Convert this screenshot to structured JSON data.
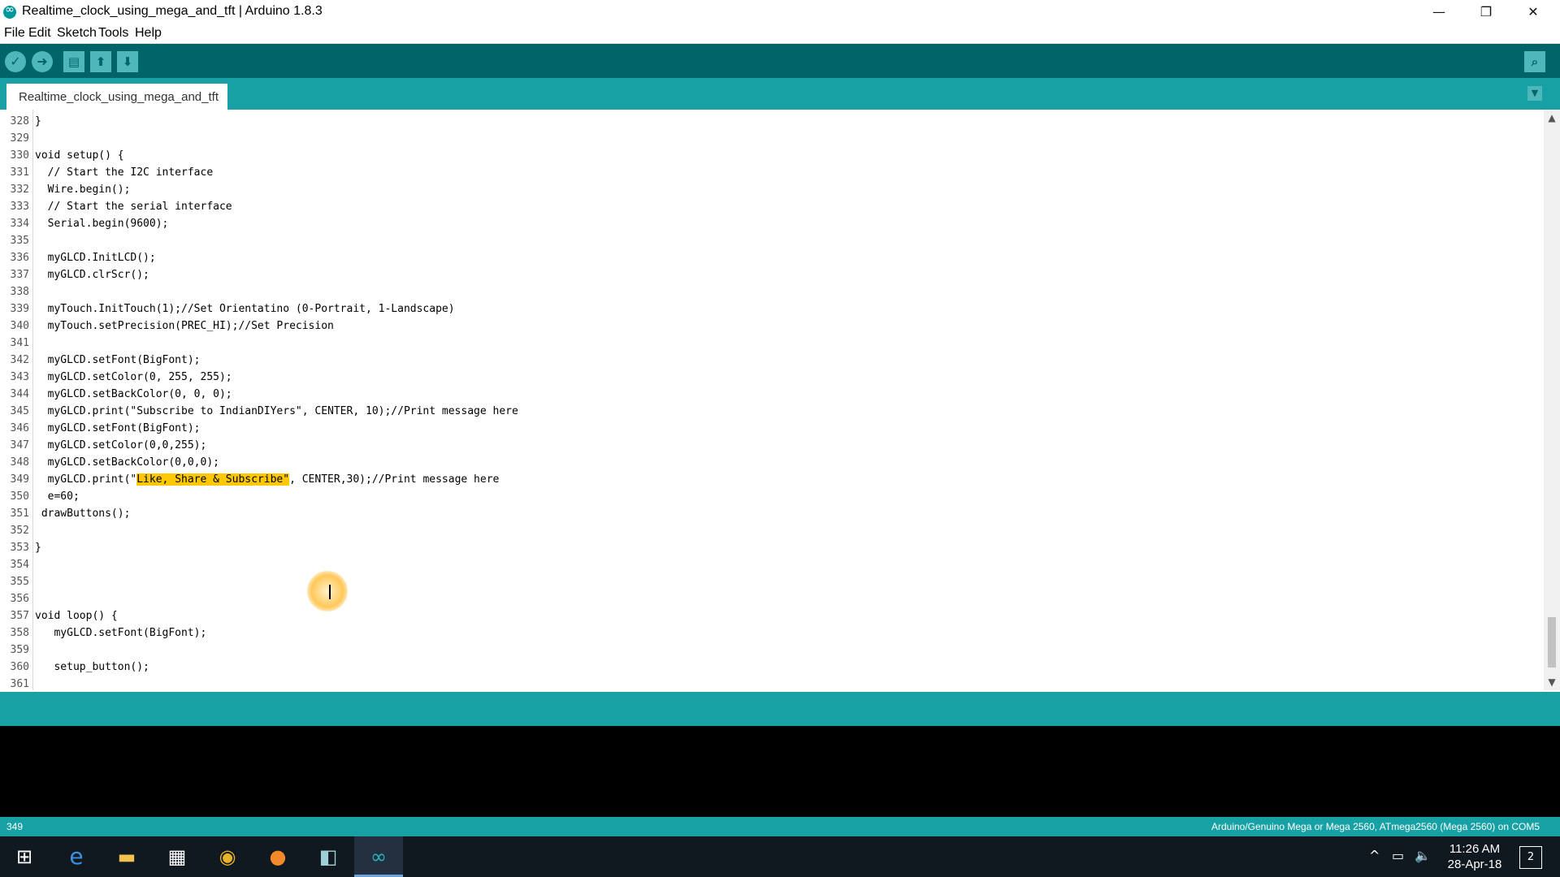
{
  "window": {
    "title": "Realtime_clock_using_mega_and_tft | Arduino 1.8.3",
    "minimize": "—",
    "maximize": "❐",
    "close": "✕"
  },
  "menu": [
    "File",
    "Edit",
    "Sketch",
    "Tools",
    "Help"
  ],
  "toolbar": {
    "verify_icon": "✓",
    "upload_icon": "➜",
    "new_icon": "▤",
    "open_icon": "⬆",
    "save_icon": "⬇",
    "serial_icon": "⌕"
  },
  "tab": {
    "name": "Realtime_clock_using_mega_and_tft",
    "menu_icon": "▼"
  },
  "code": [
    {
      "n": "328",
      "t": "}"
    },
    {
      "n": "329",
      "t": ""
    },
    {
      "n": "330",
      "t": "void setup() {"
    },
    {
      "n": "331",
      "t": "  // Start the I2C interface"
    },
    {
      "n": "332",
      "t": "  Wire.begin();"
    },
    {
      "n": "333",
      "t": "  // Start the serial interface"
    },
    {
      "n": "334",
      "t": "  Serial.begin(9600);"
    },
    {
      "n": "335",
      "t": ""
    },
    {
      "n": "336",
      "t": "  myGLCD.InitLCD();"
    },
    {
      "n": "337",
      "t": "  myGLCD.clrScr();"
    },
    {
      "n": "338",
      "t": ""
    },
    {
      "n": "339",
      "t": "  myTouch.InitTouch(1);//Set Orientatino (0-Portrait, 1-Landscape)"
    },
    {
      "n": "340",
      "t": "  myTouch.setPrecision(PREC_HI);//Set Precision"
    },
    {
      "n": "341",
      "t": ""
    },
    {
      "n": "342",
      "t": "  myGLCD.setFont(BigFont);"
    },
    {
      "n": "343",
      "t": "  myGLCD.setColor(0, 255, 255);"
    },
    {
      "n": "344",
      "t": "  myGLCD.setBackColor(0, 0, 0);"
    },
    {
      "n": "345",
      "t": "  myGLCD.print(\"Subscribe to IndianDIYers\", CENTER, 10);//Print message here"
    },
    {
      "n": "346",
      "t": "  myGLCD.setFont(BigFont);"
    },
    {
      "n": "347",
      "t": "  myGLCD.setColor(0,0,255);"
    },
    {
      "n": "348",
      "t": "  myGLCD.setBackColor(0,0,0);"
    },
    {
      "n": "349",
      "t": "  myGLCD.print(\"",
      "hl": "Like, Share & Subscribe\"",
      "t2": ", CENTER,30);//Print message here"
    },
    {
      "n": "350",
      "t": "  e=60;"
    },
    {
      "n": "351",
      "t": " drawButtons();"
    },
    {
      "n": "352",
      "t": ""
    },
    {
      "n": "353",
      "t": "}"
    },
    {
      "n": "354",
      "t": ""
    },
    {
      "n": "355",
      "t": ""
    },
    {
      "n": "356",
      "t": ""
    },
    {
      "n": "357",
      "t": "void loop() {"
    },
    {
      "n": "358",
      "t": "   myGLCD.setFont(BigFont);"
    },
    {
      "n": "359",
      "t": ""
    },
    {
      "n": "360",
      "t": "   setup_button();"
    },
    {
      "n": "361",
      "t": ""
    }
  ],
  "scroll": {
    "up": "▲",
    "down": "▼"
  },
  "status": {
    "line": "349",
    "board": "Arduino/Genuino Mega or Mega 2560, ATmega2560 (Mega 2560) on COM5"
  },
  "taskbar": {
    "apps": [
      {
        "name": "start",
        "icon": "⊞",
        "color": "#ffffff"
      },
      {
        "name": "edge",
        "icon": "e",
        "color": "#3d8fe0"
      },
      {
        "name": "file-explorer",
        "icon": "▬",
        "color": "#f2c14e"
      },
      {
        "name": "store",
        "icon": "▦",
        "color": "#ffffff"
      },
      {
        "name": "chrome",
        "icon": "◉",
        "color": "#e8b32a"
      },
      {
        "name": "firefox",
        "icon": "●",
        "color": "#f28a2a"
      },
      {
        "name": "media-app",
        "icon": "◧",
        "color": "#9fd0d8"
      },
      {
        "name": "arduino",
        "icon": "∞",
        "color": "#26b8bd"
      }
    ],
    "tray_chevron": "^",
    "tray_battery": "▭",
    "tray_volume": "🔈",
    "time": "11:26 AM",
    "date": "28-Apr-18",
    "notifications": "2"
  }
}
